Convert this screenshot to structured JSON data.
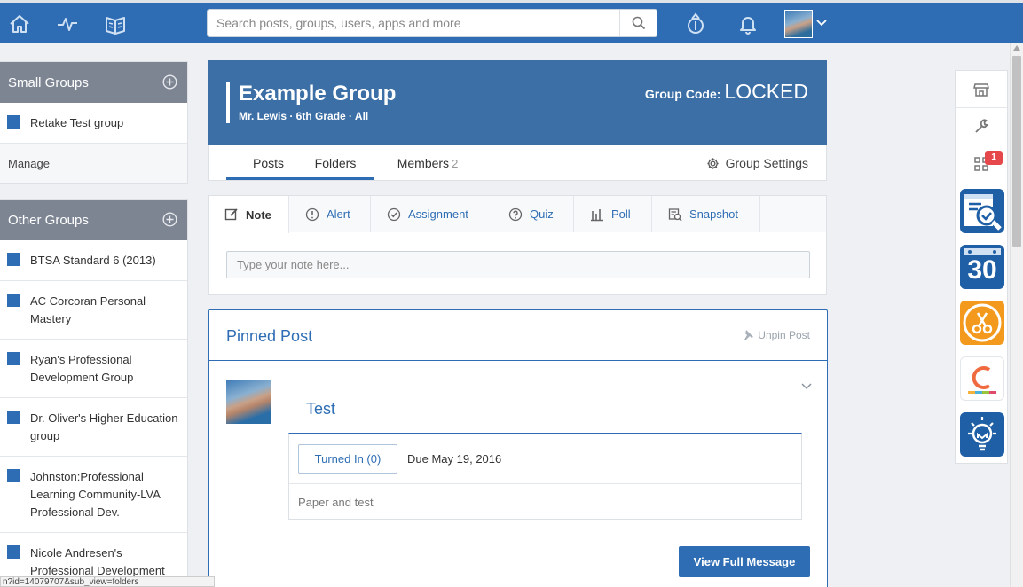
{
  "topbar": {
    "search_placeholder": "Search posts, groups, users, apps and more",
    "nav_icons": [
      "home-icon",
      "pulse-icon",
      "backpack-icon"
    ],
    "right_icons": [
      "apps-launcher-icon",
      "bell-icon"
    ]
  },
  "sidebar": {
    "small_groups": {
      "title": "Small Groups",
      "items": [
        {
          "label": "Retake Test group"
        }
      ],
      "manage_label": "Manage"
    },
    "other_groups": {
      "title": "Other Groups",
      "items": [
        {
          "label": "BTSA Standard 6 (2013)"
        },
        {
          "label": "AC Corcoran Personal Mastery"
        },
        {
          "label": "Ryan's Professional Development Group"
        },
        {
          "label": "Dr. Oliver's Higher Education group"
        },
        {
          "label": "Johnston:Professional Learning Community-LVA Professional Dev."
        },
        {
          "label": "Nicole Andresen's Professional Development"
        }
      ]
    }
  },
  "group": {
    "title": "Example Group",
    "subtitle": "Mr. Lewis · 6th Grade · All",
    "code_label": "Group Code:",
    "code_value": "LOCKED"
  },
  "tabs": {
    "posts": "Posts",
    "folders": "Folders",
    "members": "Members",
    "members_count": "2",
    "settings": "Group Settings"
  },
  "composer": {
    "tabs": [
      "Note",
      "Alert",
      "Assignment",
      "Quiz",
      "Poll",
      "Snapshot"
    ],
    "placeholder": "Type your note here..."
  },
  "pinned": {
    "title": "Pinned Post",
    "unpin_label": "Unpin Post",
    "post_title": "Test",
    "turned_in_label": "Turned In (0)",
    "due_label": "Due May 19, 2016",
    "description": "Paper and test",
    "view_full_label": "View Full Message"
  },
  "rail": {
    "badge_count": "1",
    "calendar_number": "30"
  },
  "statusbar": {
    "url": "n?id=14079707&sub_view=folders"
  },
  "colors": {
    "brand_blue": "#2e6db4",
    "header_blue": "#3c6fa6",
    "sidebar_header_gray": "#7d8593",
    "badge_red": "#e5474b"
  }
}
